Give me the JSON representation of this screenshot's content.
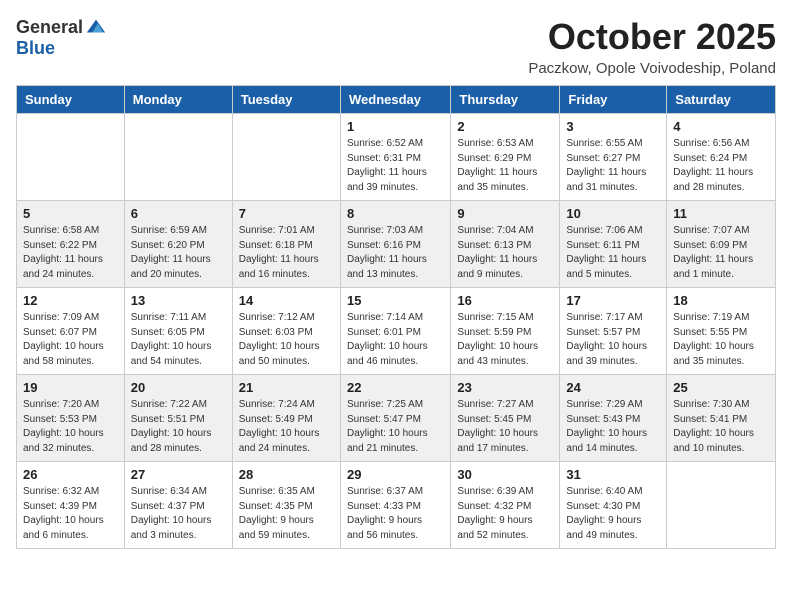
{
  "logo": {
    "general": "General",
    "blue": "Blue"
  },
  "title": "October 2025",
  "location": "Paczkow, Opole Voivodeship, Poland",
  "weekdays": [
    "Sunday",
    "Monday",
    "Tuesday",
    "Wednesday",
    "Thursday",
    "Friday",
    "Saturday"
  ],
  "weeks": [
    [
      {
        "day": "",
        "info": ""
      },
      {
        "day": "",
        "info": ""
      },
      {
        "day": "",
        "info": ""
      },
      {
        "day": "1",
        "info": "Sunrise: 6:52 AM\nSunset: 6:31 PM\nDaylight: 11 hours\nand 39 minutes."
      },
      {
        "day": "2",
        "info": "Sunrise: 6:53 AM\nSunset: 6:29 PM\nDaylight: 11 hours\nand 35 minutes."
      },
      {
        "day": "3",
        "info": "Sunrise: 6:55 AM\nSunset: 6:27 PM\nDaylight: 11 hours\nand 31 minutes."
      },
      {
        "day": "4",
        "info": "Sunrise: 6:56 AM\nSunset: 6:24 PM\nDaylight: 11 hours\nand 28 minutes."
      }
    ],
    [
      {
        "day": "5",
        "info": "Sunrise: 6:58 AM\nSunset: 6:22 PM\nDaylight: 11 hours\nand 24 minutes."
      },
      {
        "day": "6",
        "info": "Sunrise: 6:59 AM\nSunset: 6:20 PM\nDaylight: 11 hours\nand 20 minutes."
      },
      {
        "day": "7",
        "info": "Sunrise: 7:01 AM\nSunset: 6:18 PM\nDaylight: 11 hours\nand 16 minutes."
      },
      {
        "day": "8",
        "info": "Sunrise: 7:03 AM\nSunset: 6:16 PM\nDaylight: 11 hours\nand 13 minutes."
      },
      {
        "day": "9",
        "info": "Sunrise: 7:04 AM\nSunset: 6:13 PM\nDaylight: 11 hours\nand 9 minutes."
      },
      {
        "day": "10",
        "info": "Sunrise: 7:06 AM\nSunset: 6:11 PM\nDaylight: 11 hours\nand 5 minutes."
      },
      {
        "day": "11",
        "info": "Sunrise: 7:07 AM\nSunset: 6:09 PM\nDaylight: 11 hours\nand 1 minute."
      }
    ],
    [
      {
        "day": "12",
        "info": "Sunrise: 7:09 AM\nSunset: 6:07 PM\nDaylight: 10 hours\nand 58 minutes."
      },
      {
        "day": "13",
        "info": "Sunrise: 7:11 AM\nSunset: 6:05 PM\nDaylight: 10 hours\nand 54 minutes."
      },
      {
        "day": "14",
        "info": "Sunrise: 7:12 AM\nSunset: 6:03 PM\nDaylight: 10 hours\nand 50 minutes."
      },
      {
        "day": "15",
        "info": "Sunrise: 7:14 AM\nSunset: 6:01 PM\nDaylight: 10 hours\nand 46 minutes."
      },
      {
        "day": "16",
        "info": "Sunrise: 7:15 AM\nSunset: 5:59 PM\nDaylight: 10 hours\nand 43 minutes."
      },
      {
        "day": "17",
        "info": "Sunrise: 7:17 AM\nSunset: 5:57 PM\nDaylight: 10 hours\nand 39 minutes."
      },
      {
        "day": "18",
        "info": "Sunrise: 7:19 AM\nSunset: 5:55 PM\nDaylight: 10 hours\nand 35 minutes."
      }
    ],
    [
      {
        "day": "19",
        "info": "Sunrise: 7:20 AM\nSunset: 5:53 PM\nDaylight: 10 hours\nand 32 minutes."
      },
      {
        "day": "20",
        "info": "Sunrise: 7:22 AM\nSunset: 5:51 PM\nDaylight: 10 hours\nand 28 minutes."
      },
      {
        "day": "21",
        "info": "Sunrise: 7:24 AM\nSunset: 5:49 PM\nDaylight: 10 hours\nand 24 minutes."
      },
      {
        "day": "22",
        "info": "Sunrise: 7:25 AM\nSunset: 5:47 PM\nDaylight: 10 hours\nand 21 minutes."
      },
      {
        "day": "23",
        "info": "Sunrise: 7:27 AM\nSunset: 5:45 PM\nDaylight: 10 hours\nand 17 minutes."
      },
      {
        "day": "24",
        "info": "Sunrise: 7:29 AM\nSunset: 5:43 PM\nDaylight: 10 hours\nand 14 minutes."
      },
      {
        "day": "25",
        "info": "Sunrise: 7:30 AM\nSunset: 5:41 PM\nDaylight: 10 hours\nand 10 minutes."
      }
    ],
    [
      {
        "day": "26",
        "info": "Sunrise: 6:32 AM\nSunset: 4:39 PM\nDaylight: 10 hours\nand 6 minutes."
      },
      {
        "day": "27",
        "info": "Sunrise: 6:34 AM\nSunset: 4:37 PM\nDaylight: 10 hours\nand 3 minutes."
      },
      {
        "day": "28",
        "info": "Sunrise: 6:35 AM\nSunset: 4:35 PM\nDaylight: 9 hours\nand 59 minutes."
      },
      {
        "day": "29",
        "info": "Sunrise: 6:37 AM\nSunset: 4:33 PM\nDaylight: 9 hours\nand 56 minutes."
      },
      {
        "day": "30",
        "info": "Sunrise: 6:39 AM\nSunset: 4:32 PM\nDaylight: 9 hours\nand 52 minutes."
      },
      {
        "day": "31",
        "info": "Sunrise: 6:40 AM\nSunset: 4:30 PM\nDaylight: 9 hours\nand 49 minutes."
      },
      {
        "day": "",
        "info": ""
      }
    ]
  ]
}
